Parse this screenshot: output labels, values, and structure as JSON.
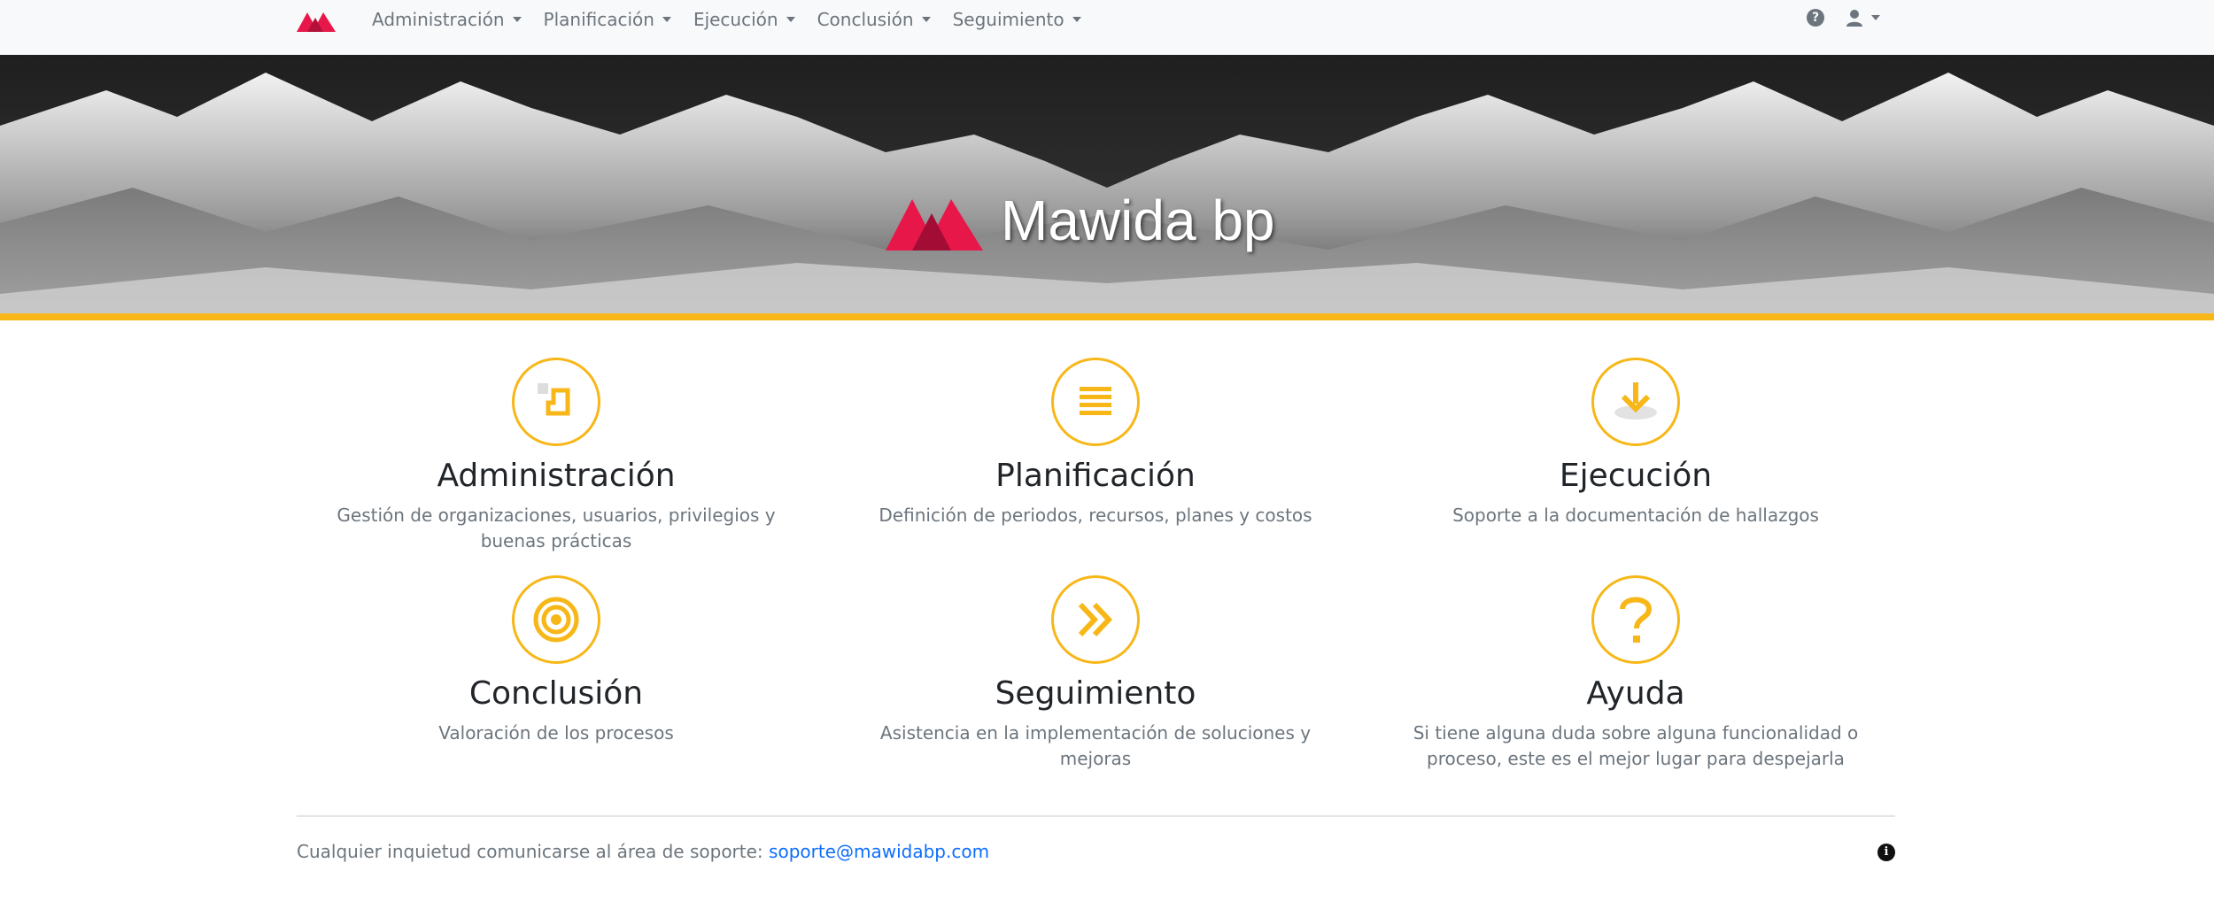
{
  "navbar": {
    "items": [
      {
        "label": "Administración"
      },
      {
        "label": "Planificación"
      },
      {
        "label": "Ejecución"
      },
      {
        "label": "Conclusión"
      },
      {
        "label": "Seguimiento"
      }
    ],
    "icons": {
      "brand": "mawida-logo",
      "help": "question-circle-icon",
      "user": "user-icon"
    }
  },
  "hero": {
    "title": "Mawida bp",
    "logo": "mawida-logo",
    "stripe_color": "#f7b718"
  },
  "cards": [
    {
      "title": "Administración",
      "description": "Gestión de organizaciones, usuarios, privilegios y buenas prácticas",
      "icon": "admin-icon"
    },
    {
      "title": "Planificación",
      "description": "Definición de periodos, recursos, planes y costos",
      "icon": "list-icon"
    },
    {
      "title": "Ejecución",
      "description": "Soporte a la documentación de hallazgos",
      "icon": "download-icon"
    },
    {
      "title": "Conclusión",
      "description": "Valoración de los procesos",
      "icon": "target-icon"
    },
    {
      "title": "Seguimiento",
      "description": "Asistencia en la implementación de soluciones y mejoras",
      "icon": "double-chevron-right-icon"
    },
    {
      "title": "Ayuda",
      "description": "Si tiene alguna duda sobre alguna funcionalidad o proceso, este es el mejor lugar para despejarla",
      "icon": "question-icon"
    }
  ],
  "footer": {
    "text": "Cualquier inquietud comunicarse al área de soporte: ",
    "email": "soporte@mawidabp.com",
    "info_icon": "info-icon"
  },
  "colors": {
    "accent": "#f7b718",
    "brand": "#e8174a",
    "link": "#0d6efd",
    "muted": "#6c757d"
  }
}
